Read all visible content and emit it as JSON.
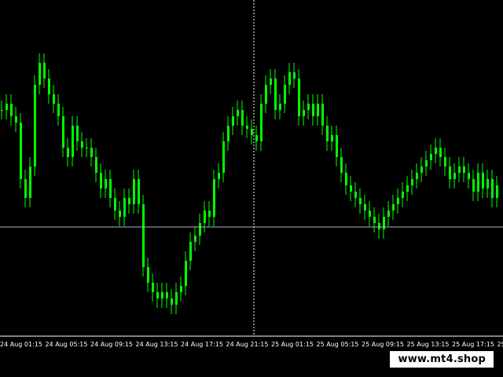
{
  "chart_data": {
    "type": "line",
    "title": "",
    "xlabel": "",
    "ylabel": "",
    "x_tick_labels": [
      "24 Aug 01:15",
      "24 Aug 05:15",
      "24 Aug 09:15",
      "24 Aug 13:15",
      "24 Aug 17:15",
      "24 Aug 21:15",
      "25 Aug 01:15",
      "25 Aug 05:15",
      "25 Aug 09:15",
      "25 Aug 13:15",
      "25 Aug 17:15",
      "25"
    ],
    "series": [
      {
        "values": [
          70,
          72,
          68,
          66,
          48,
          42,
          52,
          78,
          85,
          80,
          75,
          72,
          68,
          58,
          55,
          65,
          60,
          58,
          58,
          55,
          50,
          45,
          48,
          42,
          38,
          36,
          42,
          40,
          48,
          40,
          20,
          15,
          12,
          10,
          12,
          10,
          8,
          12,
          14,
          22,
          28,
          30,
          34,
          38,
          36,
          48,
          50,
          60,
          65,
          68,
          70,
          65,
          64,
          62,
          60,
          72,
          78,
          80,
          70,
          72,
          78,
          82,
          80,
          68,
          70,
          72,
          68,
          72,
          65,
          60,
          62,
          55,
          50,
          46,
          44,
          42,
          40,
          38,
          36,
          34,
          32,
          36,
          38,
          40,
          42,
          44,
          46,
          48,
          50,
          52,
          54,
          56,
          58,
          55,
          52,
          48,
          50,
          52,
          50,
          48,
          44,
          50,
          45,
          48,
          42,
          46
        ]
      }
    ],
    "crosshair_label": "24 Aug 21:15",
    "colors": {
      "background": "#000000",
      "candles": "#00ff00",
      "axis_text": "#ffffff",
      "crosshair": "#ffffff",
      "hline": "#aab4cc"
    },
    "grid": false
  },
  "watermark": "www.mt4.shop"
}
